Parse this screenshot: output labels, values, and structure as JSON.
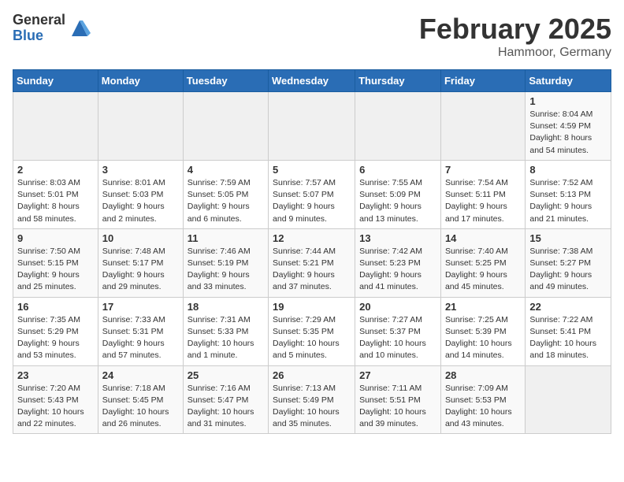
{
  "header": {
    "logo_general": "General",
    "logo_blue": "Blue",
    "month_title": "February 2025",
    "location": "Hammoor, Germany"
  },
  "weekdays": [
    "Sunday",
    "Monday",
    "Tuesday",
    "Wednesday",
    "Thursday",
    "Friday",
    "Saturday"
  ],
  "weeks": [
    [
      {
        "day": "",
        "info": ""
      },
      {
        "day": "",
        "info": ""
      },
      {
        "day": "",
        "info": ""
      },
      {
        "day": "",
        "info": ""
      },
      {
        "day": "",
        "info": ""
      },
      {
        "day": "",
        "info": ""
      },
      {
        "day": "1",
        "info": "Sunrise: 8:04 AM\nSunset: 4:59 PM\nDaylight: 8 hours and 54 minutes."
      }
    ],
    [
      {
        "day": "2",
        "info": "Sunrise: 8:03 AM\nSunset: 5:01 PM\nDaylight: 8 hours and 58 minutes."
      },
      {
        "day": "3",
        "info": "Sunrise: 8:01 AM\nSunset: 5:03 PM\nDaylight: 9 hours and 2 minutes."
      },
      {
        "day": "4",
        "info": "Sunrise: 7:59 AM\nSunset: 5:05 PM\nDaylight: 9 hours and 6 minutes."
      },
      {
        "day": "5",
        "info": "Sunrise: 7:57 AM\nSunset: 5:07 PM\nDaylight: 9 hours and 9 minutes."
      },
      {
        "day": "6",
        "info": "Sunrise: 7:55 AM\nSunset: 5:09 PM\nDaylight: 9 hours and 13 minutes."
      },
      {
        "day": "7",
        "info": "Sunrise: 7:54 AM\nSunset: 5:11 PM\nDaylight: 9 hours and 17 minutes."
      },
      {
        "day": "8",
        "info": "Sunrise: 7:52 AM\nSunset: 5:13 PM\nDaylight: 9 hours and 21 minutes."
      }
    ],
    [
      {
        "day": "9",
        "info": "Sunrise: 7:50 AM\nSunset: 5:15 PM\nDaylight: 9 hours and 25 minutes."
      },
      {
        "day": "10",
        "info": "Sunrise: 7:48 AM\nSunset: 5:17 PM\nDaylight: 9 hours and 29 minutes."
      },
      {
        "day": "11",
        "info": "Sunrise: 7:46 AM\nSunset: 5:19 PM\nDaylight: 9 hours and 33 minutes."
      },
      {
        "day": "12",
        "info": "Sunrise: 7:44 AM\nSunset: 5:21 PM\nDaylight: 9 hours and 37 minutes."
      },
      {
        "day": "13",
        "info": "Sunrise: 7:42 AM\nSunset: 5:23 PM\nDaylight: 9 hours and 41 minutes."
      },
      {
        "day": "14",
        "info": "Sunrise: 7:40 AM\nSunset: 5:25 PM\nDaylight: 9 hours and 45 minutes."
      },
      {
        "day": "15",
        "info": "Sunrise: 7:38 AM\nSunset: 5:27 PM\nDaylight: 9 hours and 49 minutes."
      }
    ],
    [
      {
        "day": "16",
        "info": "Sunrise: 7:35 AM\nSunset: 5:29 PM\nDaylight: 9 hours and 53 minutes."
      },
      {
        "day": "17",
        "info": "Sunrise: 7:33 AM\nSunset: 5:31 PM\nDaylight: 9 hours and 57 minutes."
      },
      {
        "day": "18",
        "info": "Sunrise: 7:31 AM\nSunset: 5:33 PM\nDaylight: 10 hours and 1 minute."
      },
      {
        "day": "19",
        "info": "Sunrise: 7:29 AM\nSunset: 5:35 PM\nDaylight: 10 hours and 5 minutes."
      },
      {
        "day": "20",
        "info": "Sunrise: 7:27 AM\nSunset: 5:37 PM\nDaylight: 10 hours and 10 minutes."
      },
      {
        "day": "21",
        "info": "Sunrise: 7:25 AM\nSunset: 5:39 PM\nDaylight: 10 hours and 14 minutes."
      },
      {
        "day": "22",
        "info": "Sunrise: 7:22 AM\nSunset: 5:41 PM\nDaylight: 10 hours and 18 minutes."
      }
    ],
    [
      {
        "day": "23",
        "info": "Sunrise: 7:20 AM\nSunset: 5:43 PM\nDaylight: 10 hours and 22 minutes."
      },
      {
        "day": "24",
        "info": "Sunrise: 7:18 AM\nSunset: 5:45 PM\nDaylight: 10 hours and 26 minutes."
      },
      {
        "day": "25",
        "info": "Sunrise: 7:16 AM\nSunset: 5:47 PM\nDaylight: 10 hours and 31 minutes."
      },
      {
        "day": "26",
        "info": "Sunrise: 7:13 AM\nSunset: 5:49 PM\nDaylight: 10 hours and 35 minutes."
      },
      {
        "day": "27",
        "info": "Sunrise: 7:11 AM\nSunset: 5:51 PM\nDaylight: 10 hours and 39 minutes."
      },
      {
        "day": "28",
        "info": "Sunrise: 7:09 AM\nSunset: 5:53 PM\nDaylight: 10 hours and 43 minutes."
      },
      {
        "day": "",
        "info": ""
      }
    ]
  ]
}
